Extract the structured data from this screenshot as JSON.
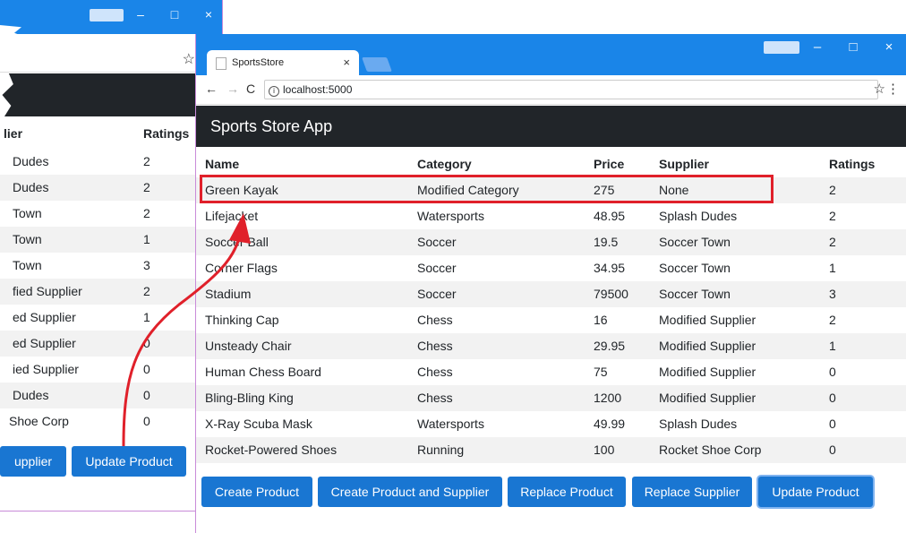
{
  "back_window": {
    "header": {
      "supplier": "lier",
      "ratings": "Ratings"
    },
    "rows": [
      {
        "supplier": "Dudes",
        "rating": "2"
      },
      {
        "supplier": "Dudes",
        "rating": "2"
      },
      {
        "supplier": "Town",
        "rating": "2"
      },
      {
        "supplier": "Town",
        "rating": "1"
      },
      {
        "supplier": "Town",
        "rating": "3"
      },
      {
        "supplier": "fied Supplier",
        "rating": "2"
      },
      {
        "supplier": "ed Supplier",
        "rating": "1"
      },
      {
        "supplier": "ed Supplier",
        "rating": "0"
      },
      {
        "supplier": "ied Supplier",
        "rating": "0"
      },
      {
        "supplier": "Dudes",
        "rating": "0"
      },
      {
        "supplier": "Shoe Corp",
        "rating": "0"
      }
    ],
    "buttons": {
      "supplier": "upplier",
      "update_product": "Update Product"
    }
  },
  "browser": {
    "tab_title": "SportsStore",
    "tab_close": "×",
    "url": "localhost:5000",
    "controls": {
      "minimize": "–",
      "maximize": "□",
      "close": "×"
    },
    "nav": {
      "back": "←",
      "forward": "→",
      "reload": "C"
    }
  },
  "app": {
    "title": "Sports Store App"
  },
  "table": {
    "columns": [
      "Name",
      "Category",
      "Price",
      "Supplier",
      "Ratings"
    ],
    "rows": [
      [
        "Green Kayak",
        "Modified Category",
        "275",
        "None",
        "2"
      ],
      [
        "Lifejacket",
        "Watersports",
        "48.95",
        "Splash Dudes",
        "2"
      ],
      [
        "Soccer Ball",
        "Soccer",
        "19.5",
        "Soccer Town",
        "2"
      ],
      [
        "Corner Flags",
        "Soccer",
        "34.95",
        "Soccer Town",
        "1"
      ],
      [
        "Stadium",
        "Soccer",
        "79500",
        "Soccer Town",
        "3"
      ],
      [
        "Thinking Cap",
        "Chess",
        "16",
        "Modified Supplier",
        "2"
      ],
      [
        "Unsteady Chair",
        "Chess",
        "29.95",
        "Modified Supplier",
        "1"
      ],
      [
        "Human Chess Board",
        "Chess",
        "75",
        "Modified Supplier",
        "0"
      ],
      [
        "Bling-Bling King",
        "Chess",
        "1200",
        "Modified Supplier",
        "0"
      ],
      [
        "X-Ray Scuba Mask",
        "Watersports",
        "49.99",
        "Splash Dudes",
        "0"
      ],
      [
        "Rocket-Powered Shoes",
        "Running",
        "100",
        "Rocket Shoe Corp",
        "0"
      ]
    ]
  },
  "buttons": {
    "create_product": "Create Product",
    "create_product_supplier": "Create Product and Supplier",
    "replace_product": "Replace Product",
    "replace_supplier": "Replace Supplier",
    "update_product": "Update Product"
  },
  "colors": {
    "titlebar": "#1a85e8",
    "button": "#1976d2",
    "highlight": "#e0202a",
    "appbar": "#212529"
  }
}
